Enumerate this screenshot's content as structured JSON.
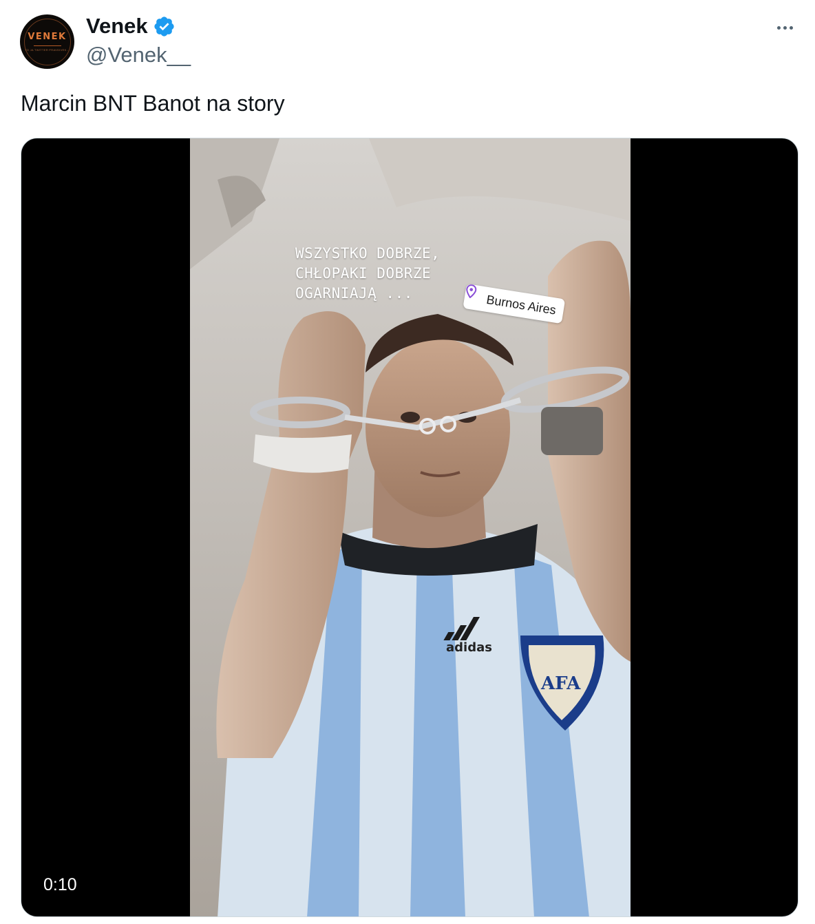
{
  "tweet": {
    "avatar": {
      "word": "VENEK",
      "subtitle": "TO JA TWITTER PRAVDIVEK..."
    },
    "author": {
      "display_name": "Venek",
      "handle": "@Venek__",
      "verified": true
    },
    "text": "Marcin BNT Banot na story",
    "media": {
      "type": "video",
      "duration": "0:10",
      "story_caption": "WSZYSTKO DOBRZE,\nCHŁOPAKI DOBRZE\nOGARNIAJĄ ...",
      "location_sticker": "Burnos Aires",
      "jersey_brand": "adidas",
      "crest_text": "AFA"
    }
  },
  "icons": {
    "verified": "verified-badge-icon",
    "more": "more-options-icon",
    "location": "location-pin-icon"
  },
  "colors": {
    "verified_blue": "#1d9bf0",
    "handle_gray": "#536471",
    "text": "#0f1419",
    "media_bg": "#000000",
    "avatar_accent": "#e07a3a",
    "pin_purple": "#8a4fd6"
  }
}
